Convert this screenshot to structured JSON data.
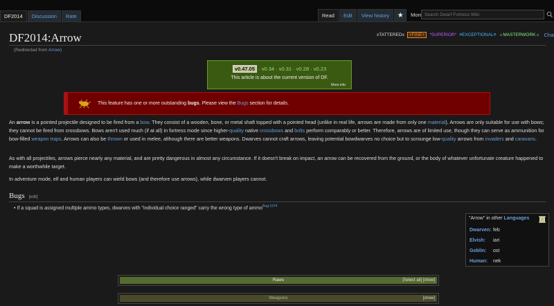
{
  "tabs_left": [
    "DF2014",
    "Discussion",
    "Rate"
  ],
  "tabs_right": {
    "read": "Read",
    "edit": "Edit",
    "history": "View history",
    "star": "★",
    "more": "More ▾"
  },
  "search": {
    "placeholder": "Search Dwarf Fortress Wiki"
  },
  "title": "DF2014:Arrow",
  "redirect": {
    "prefix": "(Redirected from ",
    "link": "Arrow",
    "suffix": ")"
  },
  "quality": {
    "tattered": "xTATTEREDx",
    "fine": "+FINE+",
    "superior": "*SUPERIOR*",
    "exceptional": "≡EXCEPTIONAL≡",
    "masterwork": "☼MASTERWORK☼",
    "change": "Change"
  },
  "versions": {
    "current": "v0.47.05",
    "others": [
      "v0.34",
      "v0.31",
      "v0.28",
      "v0.23"
    ],
    "sep": " · ",
    "desc": "This article is about the current version of DF.",
    "more": "More info"
  },
  "bugbox": {
    "pre": "This feature has one or more outstanding ",
    "bold": "bugs",
    "mid": ". Please view the ",
    "link": "Bugs",
    "post": " section for details."
  },
  "para1": [
    {
      "t": "An "
    },
    {
      "t": "arrow",
      "b": true
    },
    {
      "t": " is a pointed projectile designed to be fired from a "
    },
    {
      "t": "bow",
      "l": true
    },
    {
      "t": ". They consist of a wooden, bone, or metal shaft topped with a pointed head (unlike in real life, arrows are made from only one "
    },
    {
      "t": "material",
      "l": true
    },
    {
      "t": "). Arrows are only suitable for use with bows; they cannot be fired from crossbows. Bows aren't used much (if at all) in fortress mode since higher-"
    },
    {
      "t": "quality",
      "l": true
    },
    {
      "t": " native "
    },
    {
      "t": "crossbows",
      "l": true
    },
    {
      "t": " and "
    },
    {
      "t": "bolts",
      "l": true
    },
    {
      "t": " perform comparably or better. Therefore, arrows are of limited use, though they can serve as ammunition for bow-filled "
    },
    {
      "t": "weapon traps",
      "l": true
    },
    {
      "t": ". Arrows can also be "
    },
    {
      "t": "thrown",
      "l": true
    },
    {
      "t": " or used in melee, although there are better weapons. Dwarves cannot craft arrows, leaving potential bowdwarves no choice but to scrounge low-"
    },
    {
      "t": "quality",
      "l": true
    },
    {
      "t": " arrows from "
    },
    {
      "t": "invaders",
      "l": true
    },
    {
      "t": " and "
    },
    {
      "t": "caravans",
      "l": true
    },
    {
      "t": "."
    }
  ],
  "para2": "As with all projectiles, arrows pierce nearly any material, and are pretty dangerous in almost any circumstance. If it doesn't break on impact, an arrow can be recovered from the ground, or the body of whatever unfortunate creature happened to make a worthwhile target.",
  "para3": "In adventure mode, elf and human players can wield bows (and therefore use arrows), while dwarven players cannot.",
  "bugs": {
    "heading": "Bugs",
    "edit": "[edit]",
    "item": "If a squad is assigned multiple ammo types, dwarves with \"individual choice ranged\" carry the wrong type of ammo",
    "ref": "Bug:1374"
  },
  "languages": {
    "pre": "\"Arrow\" in other ",
    "link": "Languages",
    "rows": [
      {
        "name": "Dwarven:",
        "word": "feb"
      },
      {
        "name": "Elvish:",
        "word": "iari"
      },
      {
        "name": "Goblin:",
        "word": "ost"
      },
      {
        "name": "Human:",
        "word": "nek"
      }
    ]
  },
  "navboxes": {
    "raws": "Raws",
    "raws_links": "[Select all] [show]",
    "weapons": "Weapons",
    "weapons_links": "[show]"
  },
  "colors": {
    "version_bg": "#3a5a12",
    "bug_bg": "#700000",
    "link": "#6b9fd8",
    "nav_bar": "#556b2f"
  }
}
